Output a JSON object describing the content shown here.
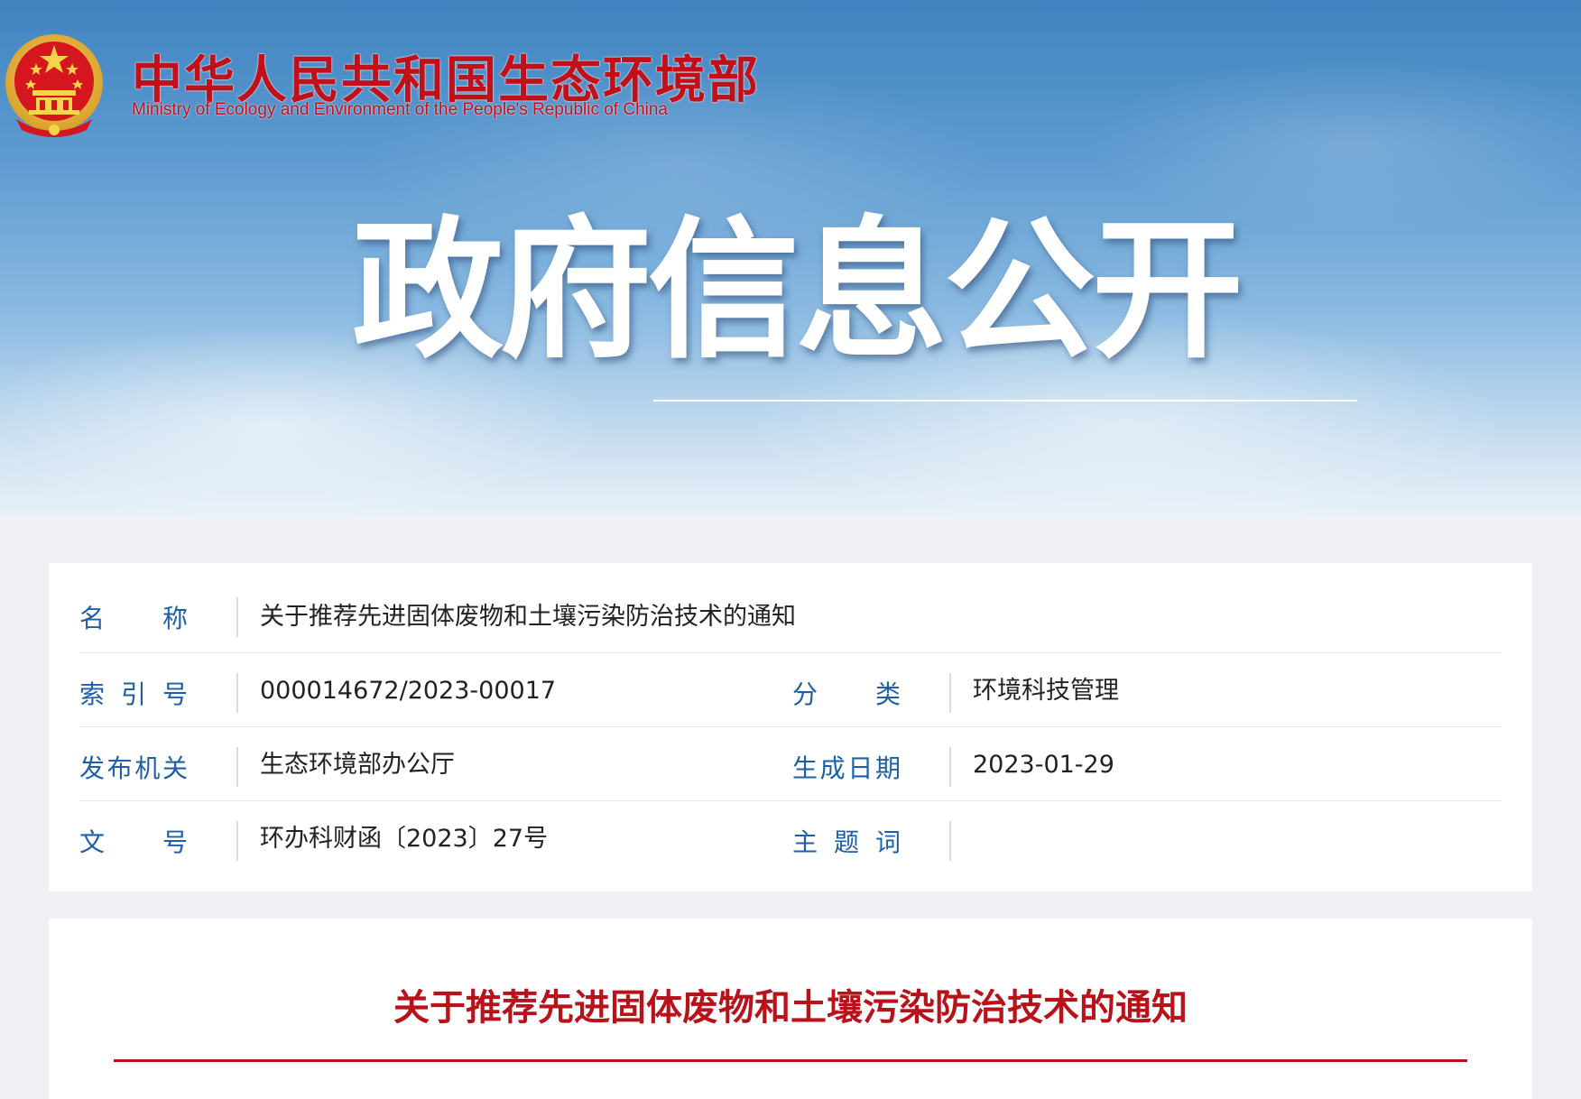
{
  "header": {
    "org_name_cn": "中华人民共和国生态环境部",
    "org_name_en": "Ministry of Ecology and Environment of the People's Republic of China",
    "banner_title": "政府信息公开",
    "brand_color": "#c0111a",
    "emblem_icon": "national-emblem-icon"
  },
  "meta": {
    "name_label": [
      "名",
      "称"
    ],
    "name_value": "关于推荐先进固体废物和土壤污染防治技术的通知",
    "index_label": [
      "索",
      "引",
      "号"
    ],
    "index_value": "000014672/2023-00017",
    "category_label": [
      "分",
      "类"
    ],
    "category_value": "环境科技管理",
    "issuer_label": [
      "发",
      "布",
      "机",
      "关"
    ],
    "issuer_value": "生态环境部办公厅",
    "date_label": [
      "生",
      "成",
      "日",
      "期"
    ],
    "date_value": "2023-01-29",
    "docno_label": [
      "文",
      "号"
    ],
    "docno_value": "环办科财函〔2023〕27号",
    "keywords_label": [
      "主",
      "题",
      "词"
    ],
    "keywords_value": "",
    "label_color": "#1e5fa8"
  },
  "document": {
    "title": "关于推荐先进固体废物和土壤污染防治技术的通知",
    "title_color": "#b8121b"
  }
}
